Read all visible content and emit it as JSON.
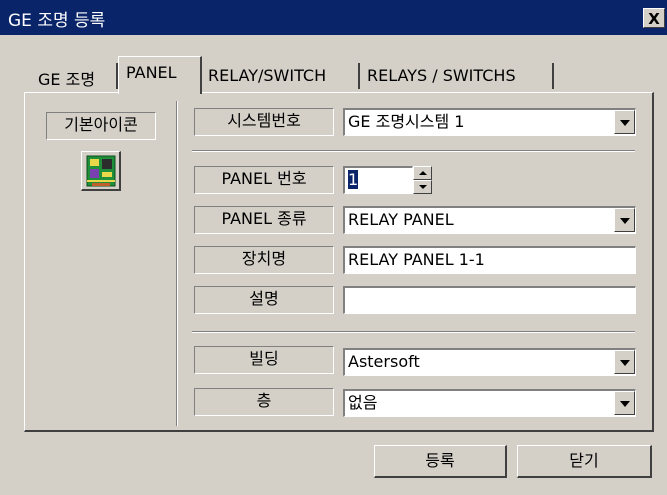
{
  "window": {
    "title": "GE 조명 등록",
    "close_label": "X"
  },
  "tabs": [
    {
      "label": "GE 조명"
    },
    {
      "label": "PANEL"
    },
    {
      "label": "RELAY/SWITCH"
    },
    {
      "label": "RELAYS / SWITCHS"
    }
  ],
  "active_tab": "PANEL",
  "sidebar": {
    "icon_label": "기본아이콘",
    "icon_name": "circuit-board-icon"
  },
  "form": {
    "system_no": {
      "label": "시스템번호",
      "value": "GE 조명시스템 1"
    },
    "panel_no": {
      "label": "PANEL 번호",
      "value": "1"
    },
    "panel_type": {
      "label": "PANEL 종류",
      "value": "RELAY PANEL"
    },
    "device_name": {
      "label": "장치명",
      "value": "RELAY PANEL 1-1"
    },
    "description": {
      "label": "설명",
      "value": ""
    },
    "building": {
      "label": "빌딩",
      "value": "Astersoft"
    },
    "floor": {
      "label": "층",
      "value": "없음"
    }
  },
  "buttons": {
    "register": "등록",
    "close": "닫기"
  },
  "colors": {
    "titlebar": "#0a246a",
    "face": "#d4d0c8",
    "field": "#ffffff"
  }
}
